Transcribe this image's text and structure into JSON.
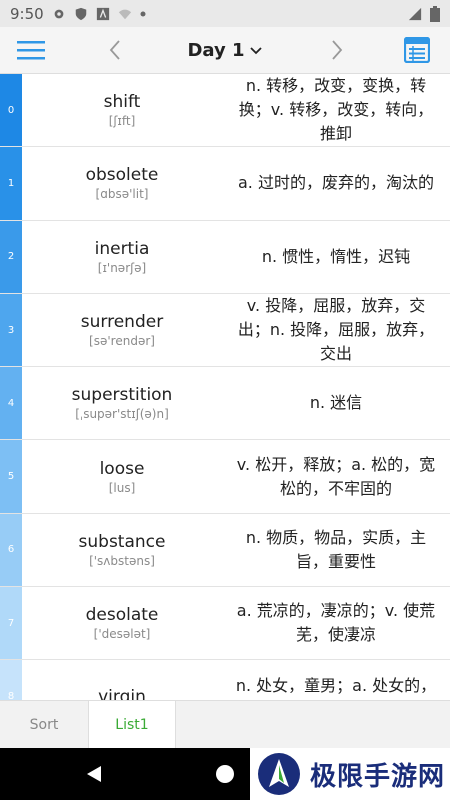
{
  "status_bar": {
    "time": "9:50"
  },
  "toolbar": {
    "title": "Day 1",
    "accent": "#2f97e6"
  },
  "entries": [
    {
      "index": "0",
      "word": "shift",
      "phonetic": "[ʃɪft]",
      "definition": "n. 转移，改变，变换，转换；v. 转移，改变，转向，推卸",
      "color": "#1e88e5"
    },
    {
      "index": "1",
      "word": "obsolete",
      "phonetic": "[ɑbsə'lit]",
      "definition": "a. 过时的，废弃的，淘汰的",
      "color": "#2991e8"
    },
    {
      "index": "2",
      "word": "inertia",
      "phonetic": "[ɪ'nərʃə]",
      "definition": "n. 惯性，惰性，迟钝",
      "color": "#3a9aea"
    },
    {
      "index": "3",
      "word": "surrender",
      "phonetic": "[sə'rendər]",
      "definition": "v. 投降，屈服，放弃，交出；n. 投降，屈服，放弃，交出",
      "color": "#4ea6ee"
    },
    {
      "index": "4",
      "word": "superstition",
      "phonetic": "[ˌsupər'stɪʃ(ə)n]",
      "definition": "n. 迷信",
      "color": "#63b1f1"
    },
    {
      "index": "5",
      "word": "loose",
      "phonetic": "[lus]",
      "definition": "v. 松开，释放；a. 松的，宽松的，不牢固的",
      "color": "#7dbff4"
    },
    {
      "index": "6",
      "word": "substance",
      "phonetic": "['sʌbstəns]",
      "definition": "n. 物质，物品，实质，主旨，重要性",
      "color": "#97ccf6"
    },
    {
      "index": "7",
      "word": "desolate",
      "phonetic": "['desələt]",
      "definition": "a. 荒凉的，凄凉的；v. 使荒芜，使凄凉",
      "color": "#b0d9f9"
    },
    {
      "index": "8",
      "word": "virgin",
      "phonetic": "",
      "definition": "n. 处女，童男；a. 处女的，",
      "color": "#c6e3fb"
    }
  ],
  "tabs": [
    {
      "label": "Sort",
      "active": false
    },
    {
      "label": "List1",
      "active": true
    }
  ],
  "watermark": {
    "text": "极限手游网"
  }
}
